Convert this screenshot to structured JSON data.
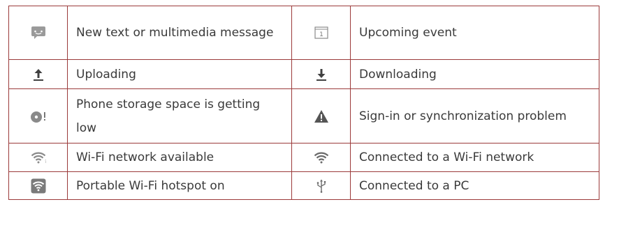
{
  "rows": [
    {
      "left": {
        "icon": "message-icon",
        "label": "New text or multimedia message"
      },
      "right": {
        "icon": "calendar-icon",
        "icon_text": "1",
        "label": "Upcoming event"
      }
    },
    {
      "left": {
        "icon": "upload-icon",
        "label": "Uploading"
      },
      "right": {
        "icon": "download-icon",
        "label": "Downloading"
      }
    },
    {
      "left": {
        "icon": "storage-low-icon",
        "label": "Phone storage space is getting low"
      },
      "right": {
        "icon": "warning-icon",
        "label": "Sign-in or synchronization problem"
      }
    },
    {
      "left": {
        "icon": "wifi-available-icon",
        "label": "Wi-Fi network available"
      },
      "right": {
        "icon": "wifi-connected-icon",
        "label": "Connected to a Wi-Fi network"
      }
    },
    {
      "left": {
        "icon": "wifi-hotspot-icon",
        "label": "Portable Wi-Fi hotspot on"
      },
      "right": {
        "icon": "usb-icon",
        "label": "Connected to a PC"
      }
    }
  ]
}
